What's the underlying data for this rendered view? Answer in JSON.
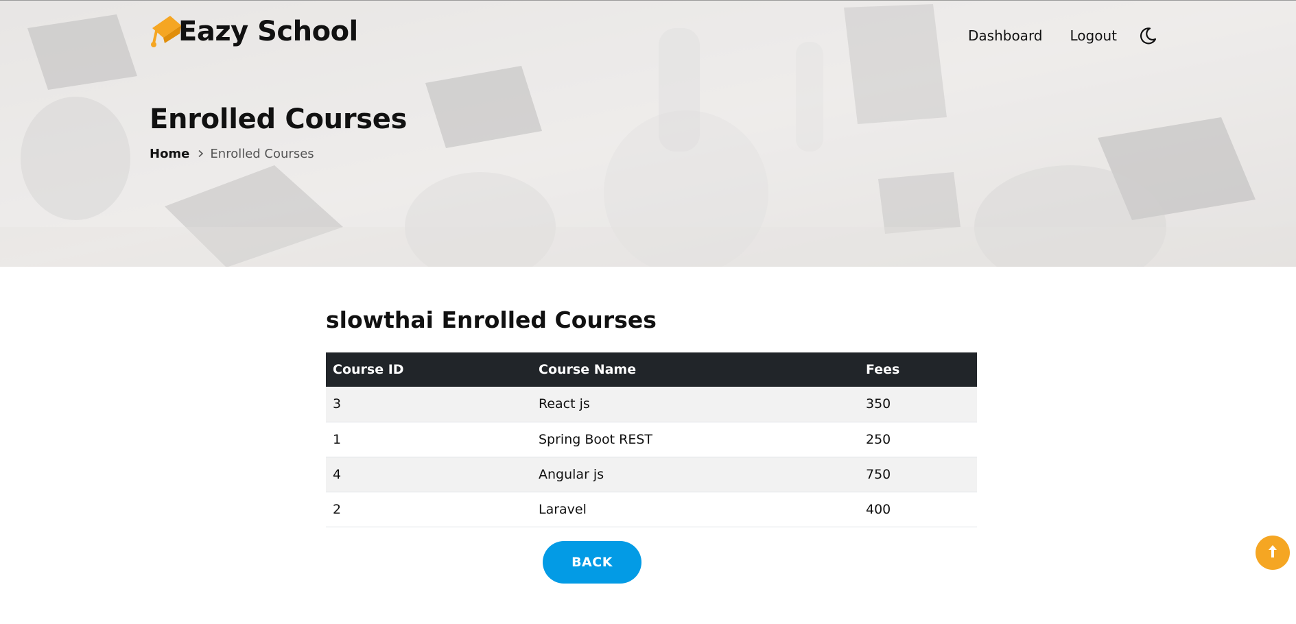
{
  "header": {
    "brand_name": "Eazy School",
    "brand_icon": "graduation-cap-icon",
    "nav": {
      "dashboard_label": "Dashboard",
      "logout_label": "Logout",
      "theme_toggle_icon": "moon-icon"
    }
  },
  "banner": {
    "page_title": "Enrolled Courses",
    "breadcrumb": {
      "home_label": "Home",
      "separator_icon": "chevron-right-icon",
      "current_label": "Enrolled Courses"
    }
  },
  "main": {
    "heading": "slowthai Enrolled Courses",
    "table": {
      "headers": [
        "Course ID",
        "Course Name",
        "Fees"
      ],
      "rows": [
        [
          "3",
          "React js",
          "350"
        ],
        [
          "1",
          "Spring Boot REST",
          "250"
        ],
        [
          "4",
          "Angular js",
          "750"
        ],
        [
          "2",
          "Laravel",
          "400"
        ]
      ]
    },
    "back_label": "BACK"
  },
  "scroll_top_icon": "arrow-up-icon",
  "colors": {
    "accent": "#039be5",
    "brand": "#f5a623",
    "table_header_bg": "#212529",
    "striped_row_bg": "#f2f2f2"
  }
}
